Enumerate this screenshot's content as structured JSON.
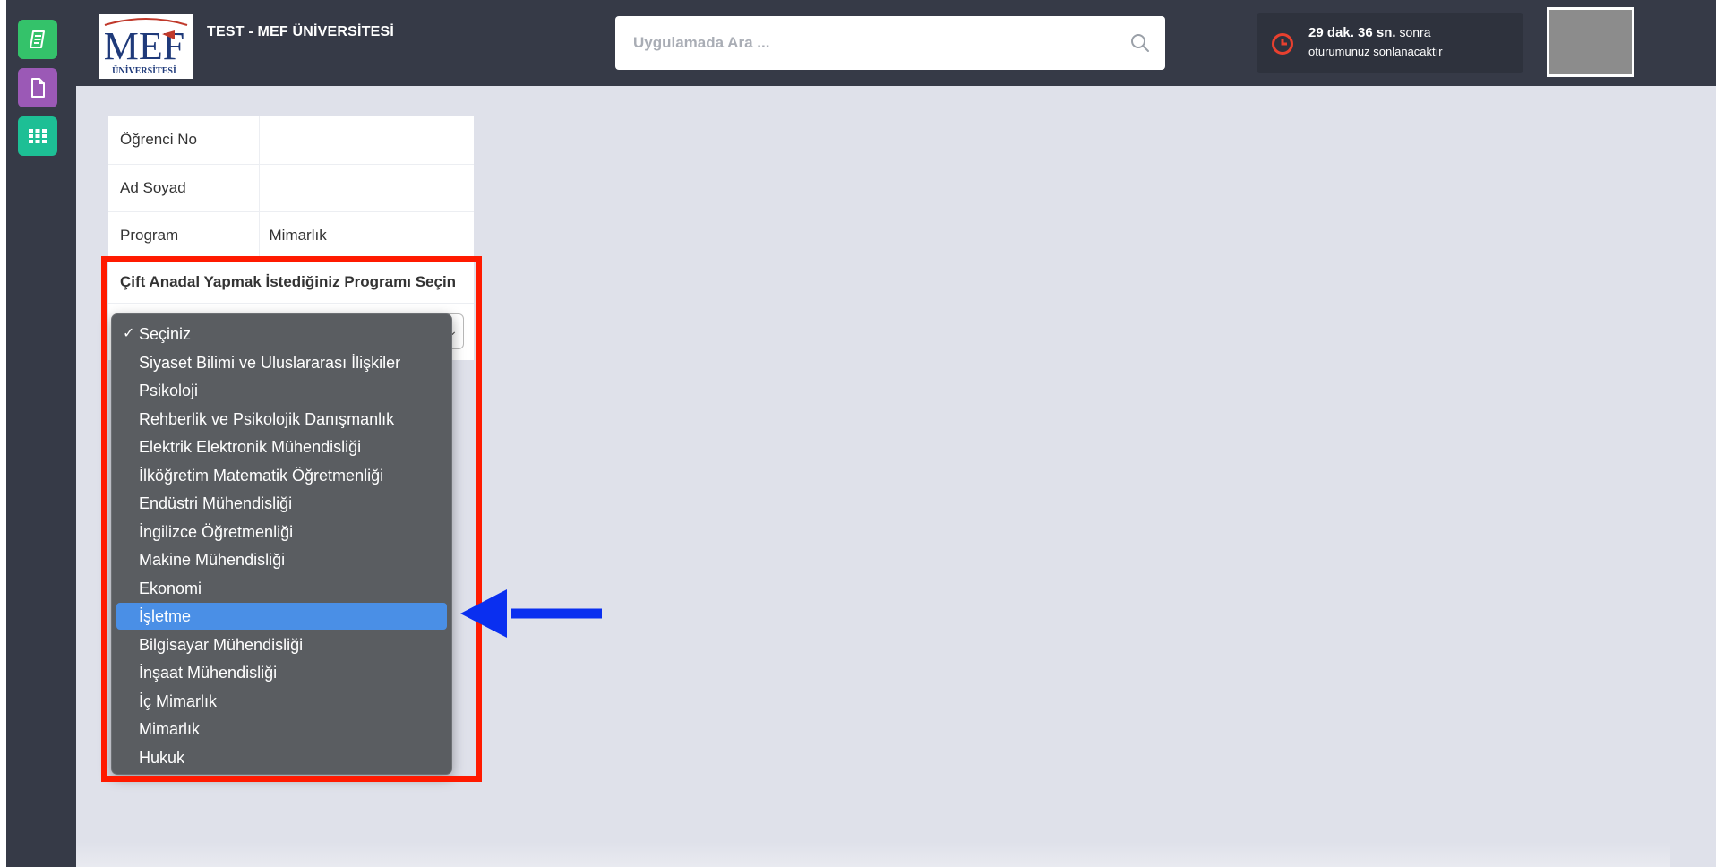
{
  "header": {
    "title": "TEST - MEF ÜNİVERSİTESİ",
    "logo_main": "MEF",
    "logo_sub": "ÜNİVERSİTESİ",
    "search_placeholder": "Uygulamada Ara ...",
    "session_time": "29 dak. 36 sn.",
    "session_suffix": "sonra",
    "session_text": "oturumunuz sonlanacaktır"
  },
  "sidebar": {
    "items": [
      {
        "icon": "book-icon",
        "color": "#34c26a"
      },
      {
        "icon": "document-icon",
        "color": "#9b59b6"
      },
      {
        "icon": "apps-grid-icon",
        "color": "#1dbf95"
      }
    ]
  },
  "student_info": {
    "rows": [
      {
        "label": "Öğrenci No",
        "value": ""
      },
      {
        "label": "Ad Soyad",
        "value": ""
      },
      {
        "label": "Program",
        "value": "Mimarlık"
      }
    ]
  },
  "double_major": {
    "heading": "Çift Anadal Yapmak İstediğiniz Programı Seçin",
    "selected": "Seçiniz",
    "highlighted": "İşletme",
    "options": [
      "Seçiniz",
      "Siyaset Bilimi ve Uluslararası İlişkiler",
      "Psikoloji",
      "Rehberlik ve Psikolojik Danışmanlık",
      "Elektrik Elektronik Mühendisliği",
      "İlköğretim Matematik Öğretmenliği",
      "Endüstri Mühendisliği",
      "İngilizce Öğretmenliği",
      "Makine Mühendisliği",
      "Ekonomi",
      "İşletme",
      "Bilgisayar Mühendisliği",
      "İnşaat Mühendisliği",
      "İç Mimarlık",
      "Mimarlık",
      "Hukuk"
    ]
  },
  "colors": {
    "header_bg": "#363a47",
    "content_bg": "#dfe1ea",
    "highlight": "#4a8fe6",
    "annotation_box": "#ff1a00",
    "annotation_arrow": "#0a2ff0"
  }
}
